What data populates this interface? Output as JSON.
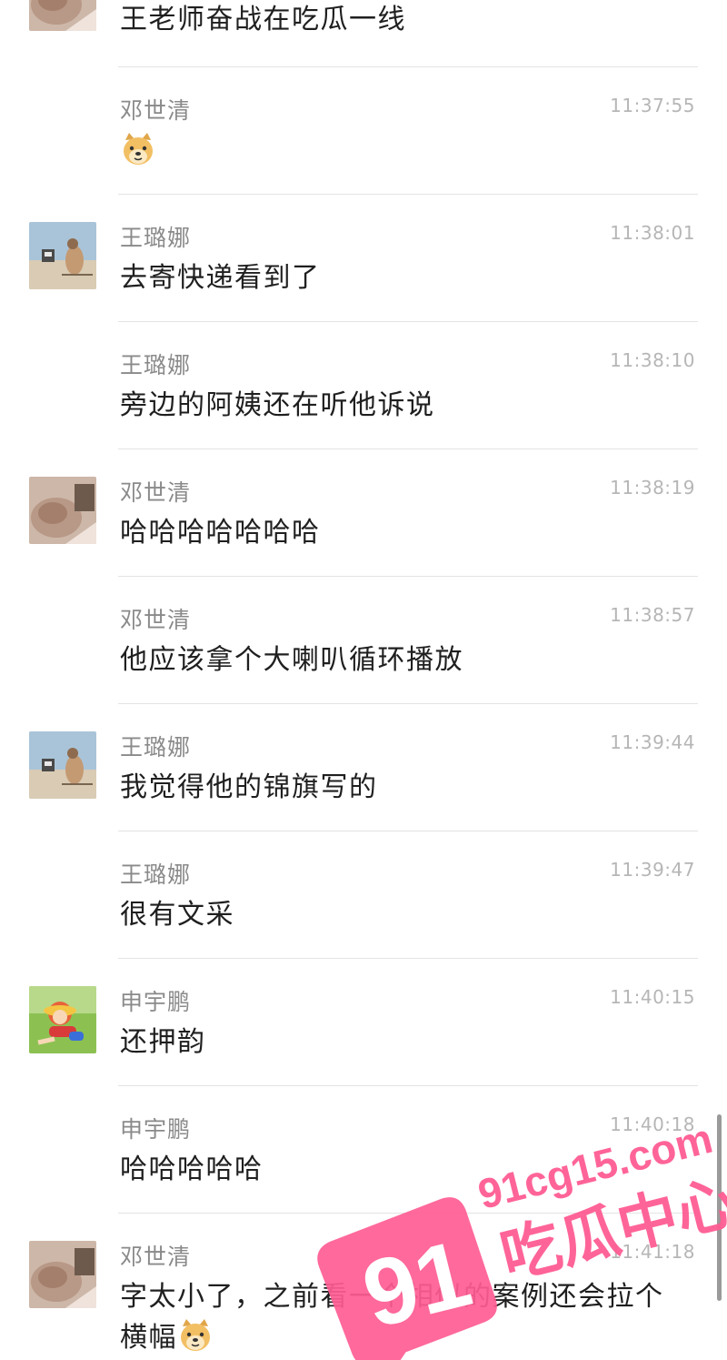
{
  "messages": [
    {
      "sender": "",
      "time": "",
      "text": "王老师奋战在吃瓜一线",
      "avatar": "cat-avatar"
    },
    {
      "sender": "邓世清",
      "time": "11:37:55",
      "text": "",
      "emoji": "doge-emoji"
    },
    {
      "sender": "王璐娜",
      "time": "11:38:01",
      "text": "去寄快递看到了",
      "avatar": "beach-avatar"
    },
    {
      "sender": "王璐娜",
      "time": "11:38:10",
      "text": "旁边的阿姨还在听他诉说"
    },
    {
      "sender": "邓世清",
      "time": "11:38:19",
      "text": "哈哈哈哈哈哈哈",
      "avatar": "cat-avatar"
    },
    {
      "sender": "邓世清",
      "time": "11:38:57",
      "text": "他应该拿个大喇叭循环播放"
    },
    {
      "sender": "王璐娜",
      "time": "11:39:44",
      "text": "我觉得他的锦旗写的",
      "avatar": "beach-avatar"
    },
    {
      "sender": "王璐娜",
      "time": "11:39:47",
      "text": "很有文采"
    },
    {
      "sender": "申宇鹏",
      "time": "11:40:15",
      "text": "还押韵",
      "avatar": "cartoon-avatar"
    },
    {
      "sender": "申宇鹏",
      "time": "11:40:18",
      "text": "哈哈哈哈哈"
    },
    {
      "sender": "邓世清",
      "time": "11:41:18",
      "text": "字太小了，之前看一个相似的案例还会拉个横幅",
      "avatar": "cat-avatar",
      "emoji": "doge-emoji"
    }
  ],
  "watermark": {
    "logo_number": "91",
    "site": "91cg15.com",
    "brand": "吃瓜中心"
  },
  "colors": {
    "name": "#8a8a8a",
    "time": "#b6b6b6",
    "text": "#1f1f1f",
    "divider": "#e3e3e3",
    "watermark_pink": "#ff5c93"
  }
}
